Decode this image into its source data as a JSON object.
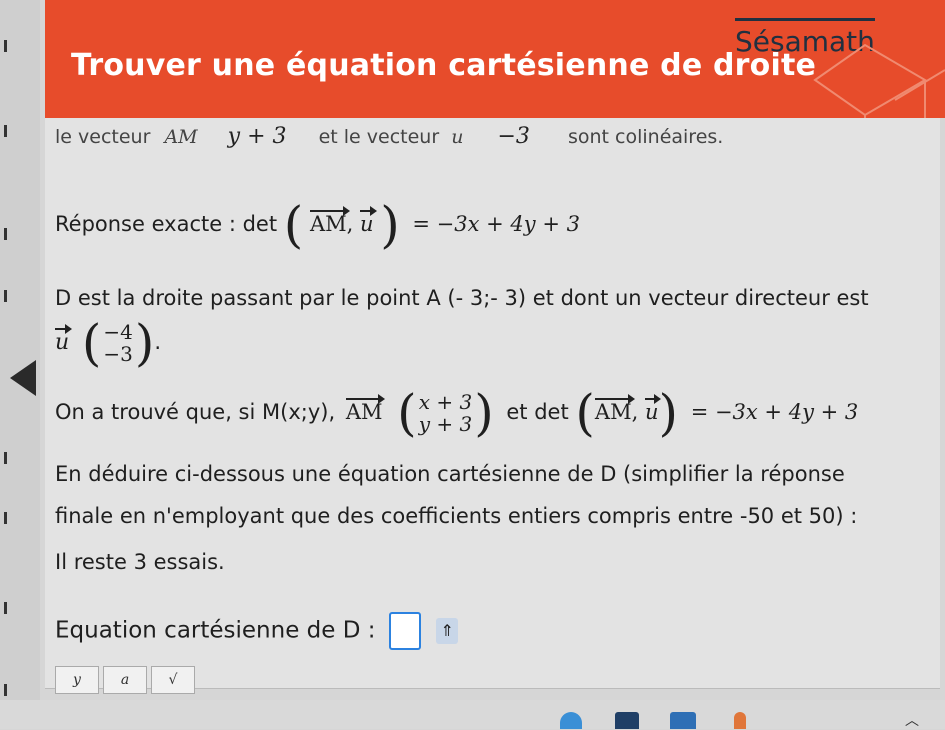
{
  "header": {
    "title": "Trouver une équation cartésienne de droite",
    "brand": "Sésamath",
    "color": "#e74c2b"
  },
  "partial_line": {
    "left_text": "le vecteur",
    "am_label": "AM",
    "y_entry": "y + 3",
    "middle_text": "et le vecteur",
    "u_label": "u",
    "u_entry": "−3",
    "right_text": "sont colinéaires."
  },
  "reponse": {
    "label": "Réponse exacte : det",
    "vec_am": "AM",
    "vec_u": "u",
    "result": "= −3x + 4y + 3"
  },
  "statement": {
    "line1": "D est la droite passant par le point A (- 3;- 3) et dont un vecteur directeur est",
    "u_label": "u",
    "u_top": "−4",
    "u_bottom": "−3",
    "dot": "."
  },
  "found": {
    "prefix": "On a trouvé que, si M(x;y),",
    "am_label": "AM",
    "am_top": "x + 3",
    "am_bottom": "y + 3",
    "middle": "et det",
    "det_am": "AM",
    "det_u": "u",
    "result": "= −3x + 4y + 3"
  },
  "instruction": {
    "line1": "En déduire ci-dessous une équation cartésienne de D (simplifier la réponse",
    "line2": "finale en n'employant que des coefficients entiers compris entre -50 et 50) :"
  },
  "tries": "Il reste 3 essais.",
  "answer": {
    "label": "Equation cartésienne de D :",
    "keyboard_icon": "⇑"
  },
  "toolbar": {
    "btn1": "y",
    "btn2": "a",
    "btn3": "√"
  },
  "accent": "#2c82e0"
}
